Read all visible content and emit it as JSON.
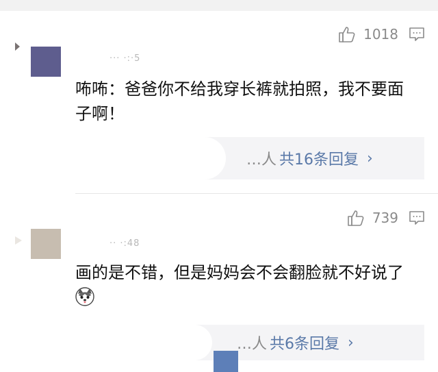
{
  "comments": [
    {
      "likes": "1018",
      "meta": "··· ·:·5",
      "text": "咘咘：爸爸你不给我穿长裤就拍照，我不要面子啊！",
      "replies_prefix": "…人",
      "replies_label": "共16条回复",
      "chevron": "›"
    },
    {
      "likes": "739",
      "meta": "·· ·:48",
      "text": "画的是不错，但是妈妈会不会翻脸就不好说了",
      "replies_prefix": "…人",
      "replies_label": "共6条回复",
      "chevron": "›"
    }
  ],
  "icons": {
    "like": "thumbs-up-icon",
    "reply": "comment-icon",
    "emoji": "husky-dog-emoji"
  },
  "colors": {
    "link": "#5a79a8",
    "muted": "#8a8a8a",
    "reply_bg": "#f4f4f6"
  }
}
